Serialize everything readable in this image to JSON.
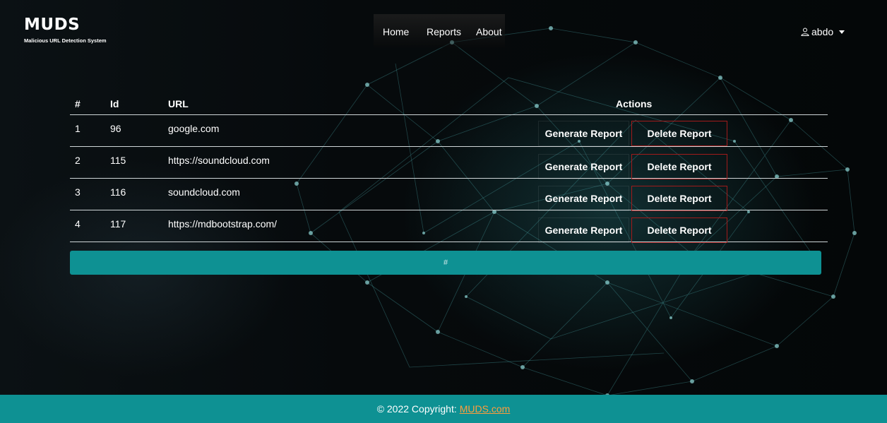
{
  "brand": {
    "title": "MUDS",
    "subtitle": "Malicious URL Detection System"
  },
  "nav": {
    "items": [
      "Home",
      "Reports",
      "About"
    ]
  },
  "user": {
    "name": "abdo",
    "icon": "user-icon"
  },
  "table": {
    "headers": {
      "index": "#",
      "id": "Id",
      "url": "URL",
      "actions": "Actions"
    },
    "rows": [
      {
        "index": "1",
        "id": "96",
        "url": "google.com"
      },
      {
        "index": "2",
        "id": "115",
        "url": "https://soundcloud.com"
      },
      {
        "index": "3",
        "id": "116",
        "url": "soundcloud.com"
      },
      {
        "index": "4",
        "id": "117",
        "url": "https://mdbootstrap.com/"
      }
    ],
    "generate_label": "Generate Report",
    "delete_label": "Delete Report"
  },
  "pager": {
    "label": "#"
  },
  "footer": {
    "text": "© 2022 Copyright:",
    "link": "MUDS.com"
  },
  "colors": {
    "accent": "#0e9193",
    "delete_border": "#a11b1b",
    "background": "#05090b"
  }
}
